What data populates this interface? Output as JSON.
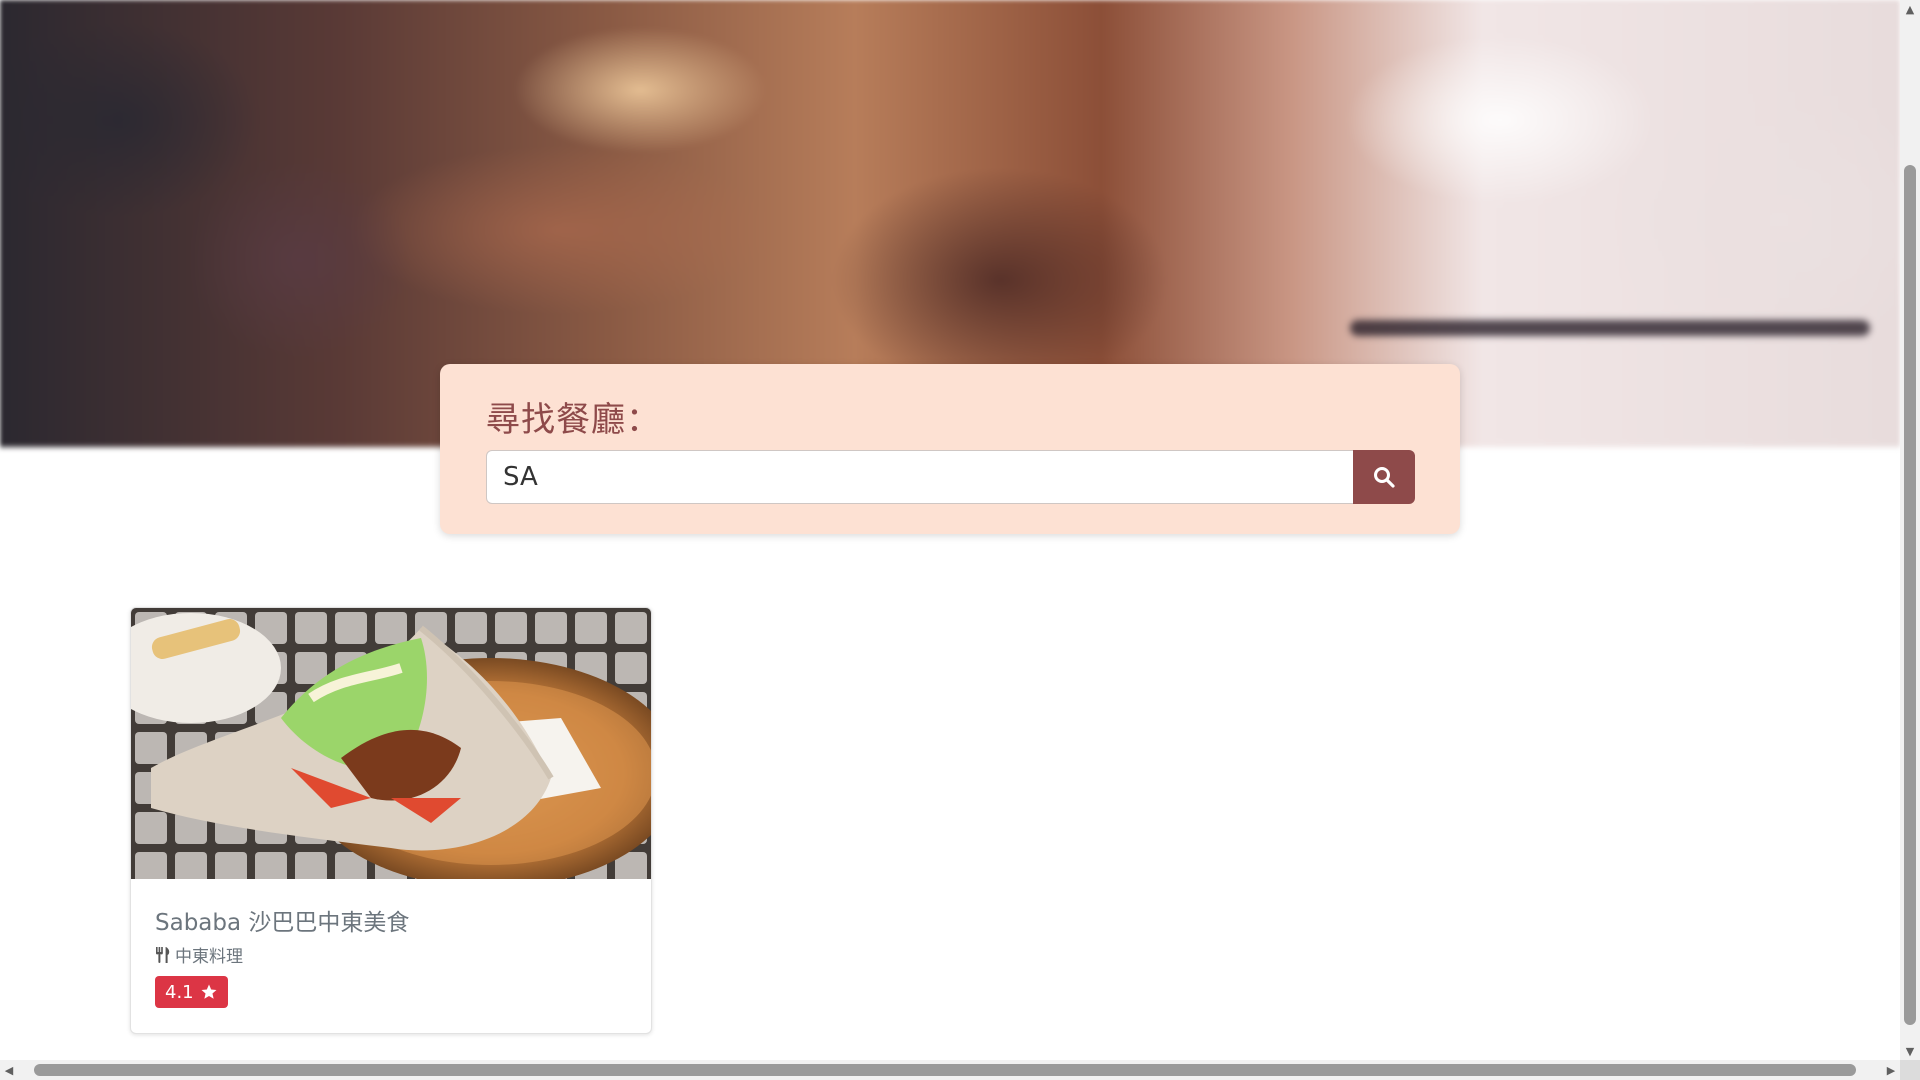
{
  "search": {
    "title": "尋找餐廳：",
    "value": "SA",
    "button_icon": "search-icon"
  },
  "results": [
    {
      "name": "Sababa 沙巴巴中東美食",
      "category_icon": "utensils-icon",
      "category": "中東料理",
      "rating": "4.1",
      "rating_icon": "star-icon",
      "image": "pita-wrap-photo"
    }
  ],
  "colors": {
    "accent": "#8e4a4a",
    "panel": "#fde1d3",
    "badge": "#dc3545",
    "muted_text": "#6c757d"
  }
}
